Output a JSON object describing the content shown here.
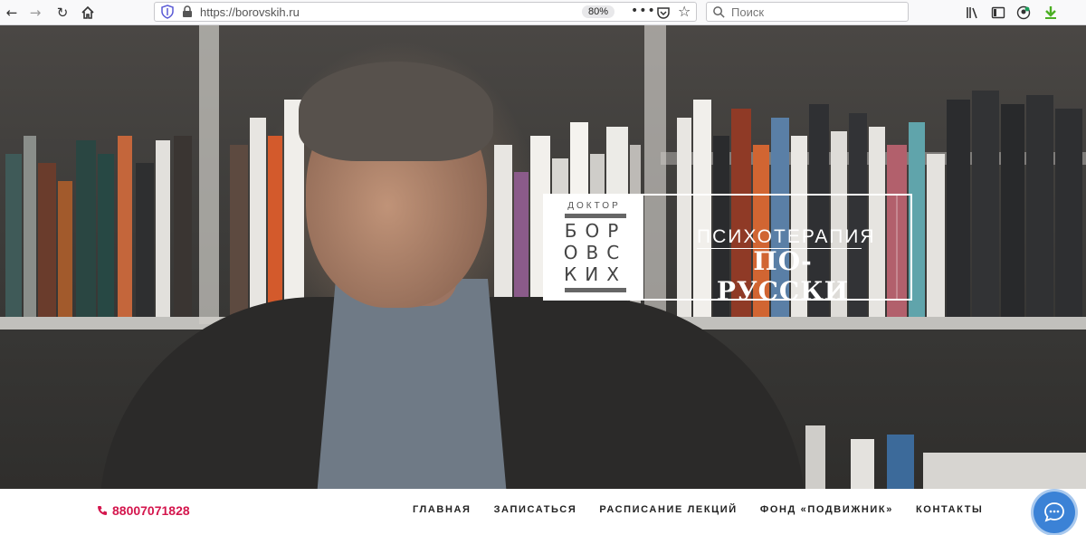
{
  "browser": {
    "url": "https://borovskih.ru",
    "zoom": "80%",
    "search_placeholder": "Поиск",
    "icons": [
      "back-arrow-icon",
      "forward-arrow-icon",
      "reload-icon",
      "home-icon",
      "shield-icon",
      "lock-icon",
      "more-icon",
      "pocket-icon",
      "star-icon",
      "search-icon",
      "library-icon",
      "sidebar-icon",
      "account-icon",
      "download-icon"
    ]
  },
  "hero": {
    "logo": {
      "doctor": "ДОКТОР",
      "letters_row1": "БОР",
      "letters_row2": "ОВС",
      "letters_row3": "КИХ",
      "title_line1": "ПСИХОТЕРАПИЯ",
      "title_line2": "ПО-РУССКИ"
    }
  },
  "nav": {
    "phone": "88007071828",
    "links": [
      "ГЛАВНАЯ",
      "ЗАПИСАТЬСЯ",
      "РАСПИСАНИЕ ЛЕКЦИЙ",
      "ФОНД «ПОДВИЖНИК»",
      "КОНТАКТЫ"
    ]
  },
  "colors": {
    "accent": "#d4164d",
    "chat": "#3b82d6"
  }
}
